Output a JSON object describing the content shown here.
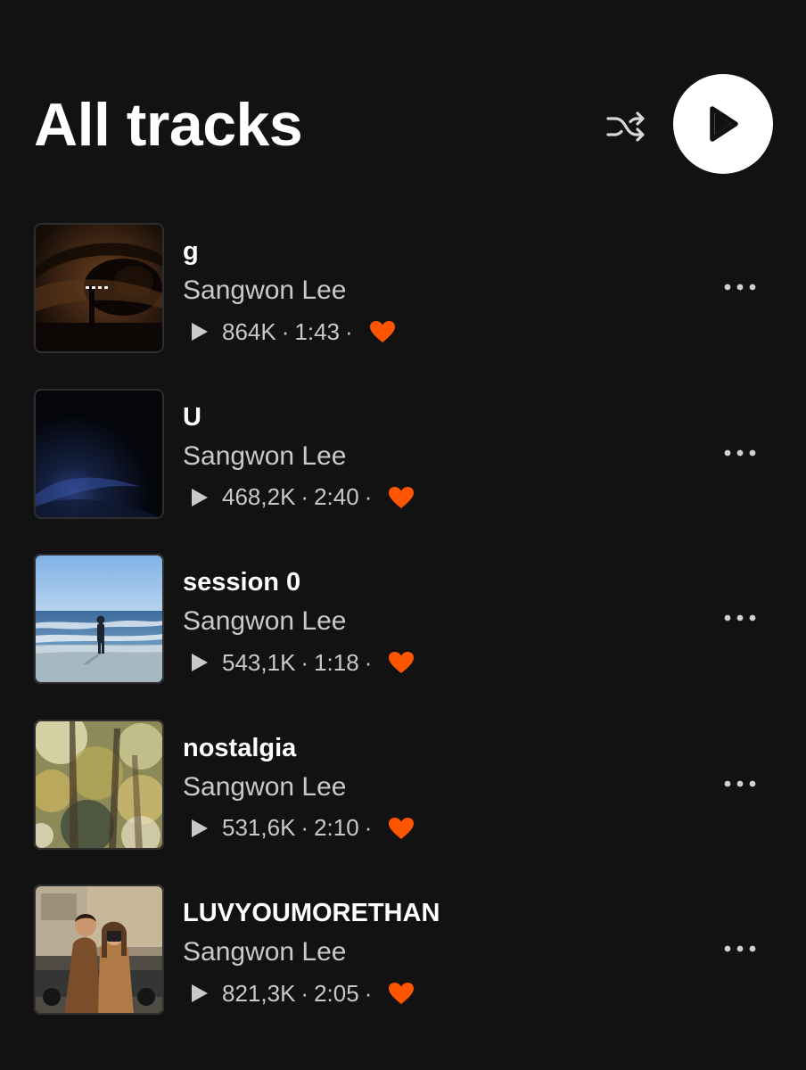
{
  "header": {
    "title": "All tracks",
    "shuffle_icon": "shuffle-icon",
    "play_icon": "play-icon"
  },
  "colors": {
    "background": "#121212",
    "primary_text": "#ffffff",
    "secondary_text": "#c9c9c9",
    "accent_like": "#ff5500",
    "play_button_bg": "#ffffff"
  },
  "tracks": [
    {
      "title": "g",
      "artist": "Sangwon Lee",
      "plays": "864K",
      "duration": "1:43",
      "separator": "·",
      "liked": true,
      "artwork": "dark-eye-artwork"
    },
    {
      "title": "U",
      "artist": "Sangwon Lee",
      "plays": "468,2K",
      "duration": "2:40",
      "separator": "·",
      "liked": true,
      "artwork": "dark-blue-artwork"
    },
    {
      "title": "session 0",
      "artist": "Sangwon Lee",
      "plays": "543,1K",
      "duration": "1:18",
      "separator": "·",
      "liked": true,
      "artwork": "beach-artwork"
    },
    {
      "title": "nostalgia",
      "artist": "Sangwon Lee",
      "plays": "531,6K",
      "duration": "2:10",
      "separator": "·",
      "liked": true,
      "artwork": "trees-artwork"
    },
    {
      "title": "LUVYOUMORETHAN",
      "artist": "Sangwon Lee",
      "plays": "821,3K",
      "duration": "2:05",
      "separator": "·",
      "liked": true,
      "artwork": "couple-artwork"
    }
  ]
}
